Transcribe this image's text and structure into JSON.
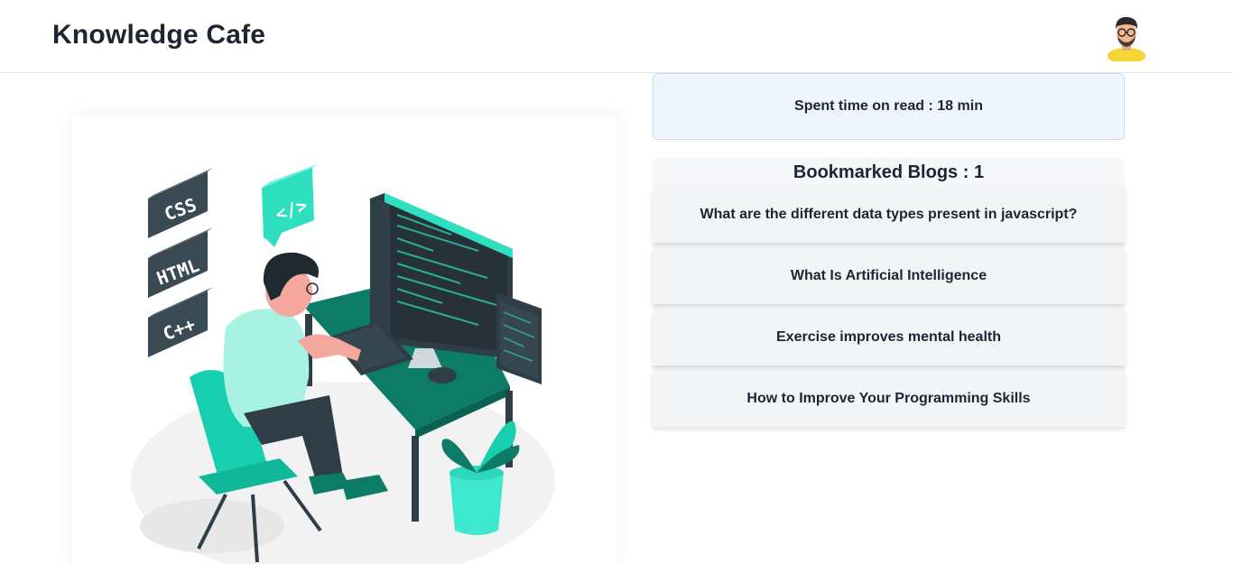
{
  "header": {
    "title": "Knowledge Cafe"
  },
  "avatar": {
    "icon": "profile-avatar-icon"
  },
  "blog": {
    "illustration": {
      "badges": [
        "CSS",
        "HTML",
        "C++"
      ],
      "code_bubble": "</>"
    }
  },
  "sidebar": {
    "spent_time_label": "Spent time on read : 18 min",
    "bookmarks_title": "Bookmarked Blogs : 1",
    "bookmarks": [
      {
        "title": "What are the different data types present in javascript?"
      },
      {
        "title": "What Is Artificial Intelligence"
      },
      {
        "title": "Exercise improves mental health"
      },
      {
        "title": "How to Improve Your Programming Skills"
      }
    ]
  },
  "colors": {
    "accent": "#17cfae",
    "teal_dark": "#0d7c66",
    "text": "#1f2433",
    "time_box_bg": "#eff5ff"
  }
}
